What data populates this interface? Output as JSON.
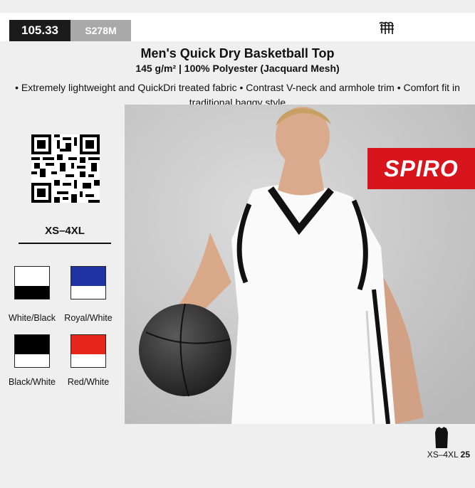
{
  "product": {
    "code": "105.33",
    "sku": "S278M",
    "title": "Men's Quick Dry Basketball Top",
    "subtitle": "145 g/m² | 100% Polyester (Jacquard Mesh)",
    "description": "• Extremely lightweight and QuickDri treated fabric • Contrast V-neck and armhole trim • Comfort fit in traditional baggy style",
    "size_range": "XS–4XL",
    "brand": "SPIRO"
  },
  "colours": [
    {
      "name": "White/Black",
      "top": "#ffffff",
      "bottom": "#000000"
    },
    {
      "name": "Royal/White",
      "top": "#1f33a3",
      "bottom": "#ffffff"
    },
    {
      "name": "Black/White",
      "top": "#000000",
      "bottom": "#ffffff"
    },
    {
      "name": "Red/White",
      "top": "#e7261b",
      "bottom": "#ffffff"
    }
  ],
  "size_info": {
    "range": "XS–4XL",
    "quantity": "25"
  },
  "icons": {
    "hanger": "hanger-icon",
    "shirt": "shirt-icon",
    "qr": "qr-code"
  }
}
